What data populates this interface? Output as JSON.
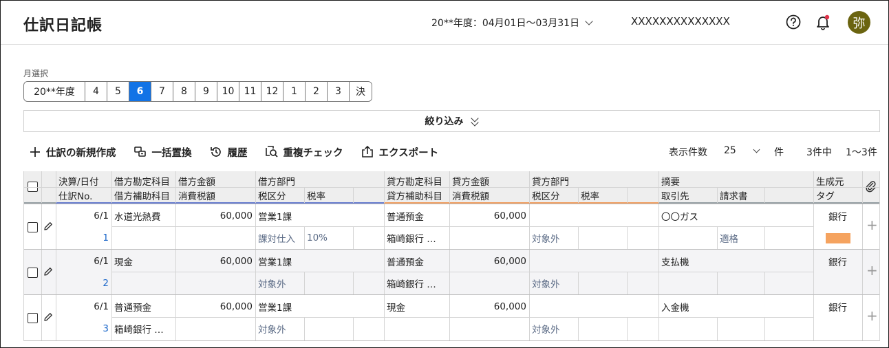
{
  "header": {
    "title": "仕訳日記帳",
    "fiscal_period": "20**年度：04月01日〜03月31日",
    "company": "XXXXXXXXXXXXXX",
    "avatar": "弥"
  },
  "month_selector": {
    "label": "月選択",
    "items": [
      "20**年度",
      "4",
      "5",
      "6",
      "7",
      "8",
      "9",
      "10",
      "11",
      "12",
      "1",
      "2",
      "3",
      "決"
    ],
    "active": "6"
  },
  "filter": {
    "label": "絞り込み"
  },
  "toolbar": {
    "new": "仕訳の新規作成",
    "bulk_replace": "一括置換",
    "history": "履歴",
    "duplicate_check": "重複チェック",
    "export": "エクスポート",
    "per_page_label": "表示件数",
    "per_page_value": "25",
    "per_page_unit": "件",
    "total": "3件中",
    "range": "1〜3件"
  },
  "table": {
    "headers": {
      "date": "決算/日付",
      "no": "仕訳No.",
      "debit_account": "借方勘定科目",
      "debit_sub": "借方補助科目",
      "debit_amount": "借方金額",
      "debit_tax_amount": "消費税額",
      "debit_dept": "借方部門",
      "debit_tax_class": "税区分",
      "debit_tax_rate": "税率",
      "credit_account": "貸方勘定科目",
      "credit_sub": "貸方補助科目",
      "credit_amount": "貸方金額",
      "credit_tax_amount": "消費税額",
      "credit_dept": "貸方部門",
      "credit_tax_class": "税区分",
      "credit_tax_rate": "税率",
      "memo": "摘要",
      "partner": "取引先",
      "invoice": "請求書",
      "source": "生成元",
      "tag": "タグ"
    },
    "rows": [
      {
        "date": "6/1",
        "no": "1",
        "debit_account": "水道光熱費",
        "debit_sub": "",
        "debit_amount": "60,000",
        "debit_tax_amount": "",
        "debit_dept": "営業1課",
        "debit_tax_class": "課対仕入",
        "debit_tax_rate": "10%",
        "credit_account": "普通預金",
        "credit_sub": "箱崎銀行 …",
        "credit_amount": "60,000",
        "credit_tax_amount": "",
        "credit_dept": "",
        "credit_tax_class": "対象外",
        "credit_tax_rate": "",
        "memo": "〇〇ガス",
        "partner": "",
        "invoice": "適格",
        "source": "銀行",
        "tag_color": "#f5a35f"
      },
      {
        "date": "6/1",
        "no": "2",
        "debit_account": "現金",
        "debit_sub": "",
        "debit_amount": "60,000",
        "debit_tax_amount": "",
        "debit_dept": "営業1課",
        "debit_tax_class": "対象外",
        "debit_tax_rate": "",
        "credit_account": "普通預金",
        "credit_sub": "箱崎銀行 …",
        "credit_amount": "60,000",
        "credit_tax_amount": "",
        "credit_dept": "",
        "credit_tax_class": "対象外",
        "credit_tax_rate": "",
        "memo": "支払機",
        "partner": "",
        "invoice": "",
        "source": "銀行",
        "tag_color": ""
      },
      {
        "date": "6/1",
        "no": "3",
        "debit_account": "普通預金",
        "debit_sub": "箱崎銀行 …",
        "debit_amount": "60,000",
        "debit_tax_amount": "",
        "debit_dept": "営業1課",
        "debit_tax_class": "対象外",
        "debit_tax_rate": "",
        "credit_account": "現金",
        "credit_sub": "",
        "credit_amount": "60,000",
        "credit_tax_amount": "",
        "credit_dept": "",
        "credit_tax_class": "対象外",
        "credit_tax_rate": "",
        "memo": "入金機",
        "partner": "",
        "invoice": "",
        "source": "銀行",
        "tag_color": ""
      }
    ]
  },
  "colors": {
    "accent": "#1273e6",
    "debit_underline": "#6a7fd0",
    "credit_underline": "#f0a064",
    "memo_underline": "#9aa3a8",
    "notification_dot": "#e0334a",
    "avatar_bg": "#6b6410"
  }
}
